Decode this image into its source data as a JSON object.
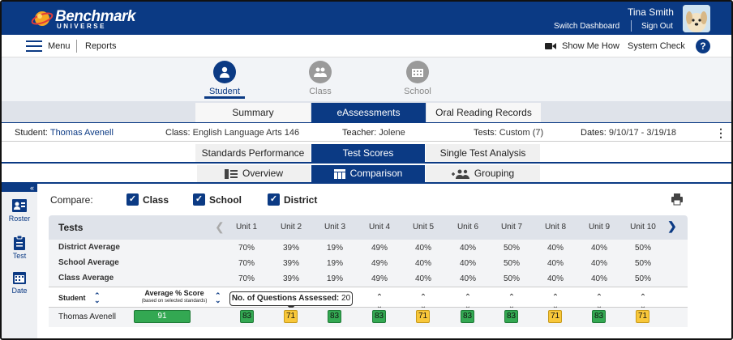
{
  "header": {
    "logo_line1": "Benchmark",
    "logo_line2": "UNIVERSE",
    "user_name": "Tina Smith",
    "switch_dashboard": "Switch Dashboard",
    "sign_out": "Sign Out"
  },
  "menubar": {
    "menu": "Menu",
    "reports": "Reports",
    "show_me_how": "Show Me How",
    "system_check": "System Check",
    "help": "?"
  },
  "roles": [
    {
      "label": "Student",
      "icon": "person-icon",
      "active": true
    },
    {
      "label": "Class",
      "icon": "group-icon",
      "active": false
    },
    {
      "label": "School",
      "icon": "school-icon",
      "active": false
    }
  ],
  "main_tabs": [
    {
      "label": "Summary",
      "active": false
    },
    {
      "label": "eAssessments",
      "active": true
    },
    {
      "label": "Oral Reading Records",
      "active": false
    }
  ],
  "info": {
    "student_label": "Student:",
    "student_value": "Thomas Avenell",
    "class_label": "Class:",
    "class_value": "English Language Arts 146",
    "teacher_label": "Teacher:",
    "teacher_value": "Jolene",
    "tests_label": "Tests:",
    "tests_value": "Custom (7)",
    "dates_label": "Dates:",
    "dates_value": "9/10/17 - 3/19/18"
  },
  "sub_tabs": [
    {
      "label": "Standards Performance",
      "active": false
    },
    {
      "label": "Test Scores",
      "active": true
    },
    {
      "label": "Single Test Analysis",
      "active": false
    }
  ],
  "view_tabs": [
    {
      "label": "Overview",
      "icon": "list-icon",
      "active": false
    },
    {
      "label": "Comparison",
      "icon": "table-icon",
      "active": true
    },
    {
      "label": "Grouping",
      "icon": "grouping-icon",
      "active": false
    }
  ],
  "sidebar": {
    "collapse": "«",
    "items": [
      {
        "label": "Roster",
        "icon": "roster-icon"
      },
      {
        "label": "Test",
        "icon": "clipboard-icon"
      },
      {
        "label": "Date",
        "icon": "calendar-icon"
      }
    ]
  },
  "compare": {
    "label": "Compare:",
    "options": [
      {
        "label": "Class",
        "checked": true
      },
      {
        "label": "School",
        "checked": true
      },
      {
        "label": "District",
        "checked": true
      }
    ]
  },
  "table": {
    "title": "Tests",
    "units": [
      "Unit 1",
      "Unit 2",
      "Unit 3",
      "Unit 4",
      "Unit 5",
      "Unit 6",
      "Unit 7",
      "Unit 8",
      "Unit 9",
      "Unit 10"
    ],
    "averages": [
      {
        "label": "District Average",
        "values": [
          "70%",
          "39%",
          "19%",
          "49%",
          "40%",
          "40%",
          "50%",
          "40%",
          "40%",
          "50%"
        ]
      },
      {
        "label": "School Average",
        "values": [
          "70%",
          "39%",
          "19%",
          "49%",
          "40%",
          "40%",
          "50%",
          "40%",
          "40%",
          "50%"
        ]
      },
      {
        "label": "Class Average",
        "values": [
          "70%",
          "39%",
          "19%",
          "49%",
          "40%",
          "40%",
          "50%",
          "40%",
          "40%",
          "50%"
        ]
      }
    ],
    "student_header": "Student",
    "avg_score_header": "Average % Score",
    "avg_score_sub": "(based on selected standards)",
    "tooltip_label": "No. of Questions Assessed:",
    "tooltip_value": "20",
    "students": [
      {
        "name": "Thomas Avenell",
        "average": "91",
        "scores": [
          {
            "value": "83",
            "color": "green"
          },
          {
            "value": "71",
            "color": "yellow"
          },
          {
            "value": "83",
            "color": "green"
          },
          {
            "value": "83",
            "color": "green"
          },
          {
            "value": "71",
            "color": "yellow"
          },
          {
            "value": "83",
            "color": "green"
          },
          {
            "value": "83",
            "color": "green"
          },
          {
            "value": "71",
            "color": "yellow"
          },
          {
            "value": "83",
            "color": "green"
          },
          {
            "value": "71",
            "color": "yellow"
          }
        ]
      }
    ]
  },
  "colors": {
    "brand": "#0b3a84",
    "score_green": "#33a852",
    "score_yellow": "#f8c73a"
  }
}
